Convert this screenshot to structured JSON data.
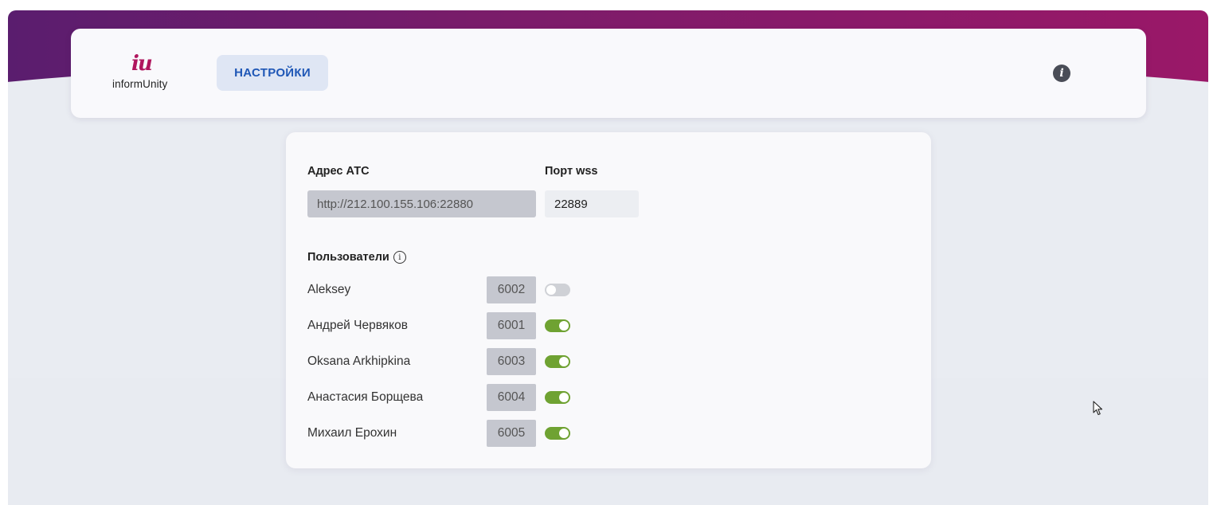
{
  "header": {
    "logo_mark": "iu",
    "logo_text": "informUnity",
    "settings_label": "НАСТРОЙКИ",
    "info_icon": "info-icon",
    "colors": {
      "band_start": "#5a1d6e",
      "band_end": "#9a1868",
      "accent": "#1f57b6"
    }
  },
  "form": {
    "atc_label": "Адрес АТС",
    "atc_value": "http://212.100.155.106:22880",
    "port_label": "Порт wss",
    "port_value": "22889"
  },
  "users": {
    "title": "Пользователи",
    "items": [
      {
        "name": "Aleksey",
        "ext": "6002",
        "enabled": false
      },
      {
        "name": "Андрей Червяков",
        "ext": "6001",
        "enabled": true
      },
      {
        "name": "Oksana Arkhipkina",
        "ext": "6003",
        "enabled": true
      },
      {
        "name": "Анастасия Борщева",
        "ext": "6004",
        "enabled": true
      },
      {
        "name": "Михаил Ерохин",
        "ext": "6005",
        "enabled": true
      }
    ],
    "toggle_on_color": "#6fa232"
  }
}
